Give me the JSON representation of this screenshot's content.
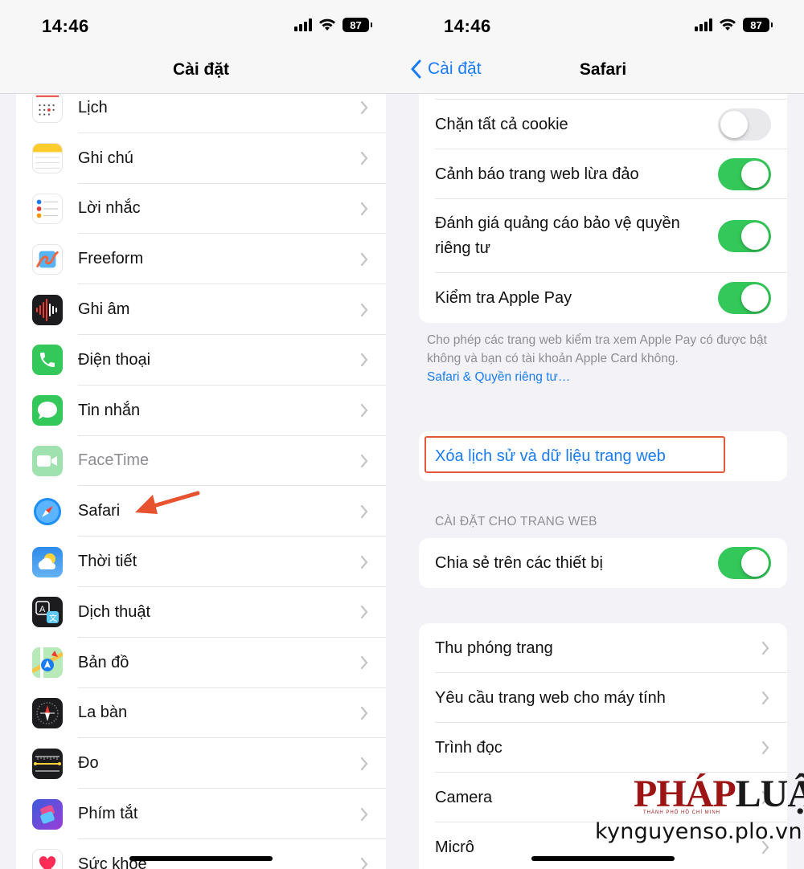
{
  "status": {
    "time": "14:46",
    "battery": "87"
  },
  "left": {
    "title": "Cài đặt",
    "items": [
      {
        "label": "Lịch",
        "icon": "calendar-icon"
      },
      {
        "label": "Ghi chú",
        "icon": "notes-icon"
      },
      {
        "label": "Lời nhắc",
        "icon": "reminders-icon"
      },
      {
        "label": "Freeform",
        "icon": "freeform-icon"
      },
      {
        "label": "Ghi âm",
        "icon": "voice-memos-icon"
      },
      {
        "label": "Điện thoại",
        "icon": "phone-icon"
      },
      {
        "label": "Tin nhắn",
        "icon": "messages-icon"
      },
      {
        "label": "FaceTime",
        "icon": "facetime-icon"
      },
      {
        "label": "Safari",
        "icon": "safari-icon"
      },
      {
        "label": "Thời tiết",
        "icon": "weather-icon"
      },
      {
        "label": "Dịch thuật",
        "icon": "translate-icon"
      },
      {
        "label": "Bản đồ",
        "icon": "maps-icon"
      },
      {
        "label": "La bàn",
        "icon": "compass-icon"
      },
      {
        "label": "Đo",
        "icon": "measure-icon"
      },
      {
        "label": "Phím tắt",
        "icon": "shortcuts-icon"
      },
      {
        "label": "Sức khỏe",
        "icon": "health-icon"
      }
    ]
  },
  "right": {
    "back_label": "Cài đặt",
    "title": "Safari",
    "privacy_group": [
      {
        "label": "Chặn tất cả cookie",
        "toggle": false
      },
      {
        "label": "Cảnh báo trang web lừa đảo",
        "toggle": true
      },
      {
        "label": "Đánh giá quảng cáo bảo vệ quyền riêng tư",
        "toggle": true
      },
      {
        "label": "Kiểm tra Apple Pay",
        "toggle": true
      }
    ],
    "footnote": "Cho phép các trang web kiểm tra xem Apple Pay có được bật không và bạn có tài khoản Apple Card không.",
    "footnote_link": "Safari & Quyền riêng tư…",
    "clear_history": "Xóa lịch sử và dữ liệu trang web",
    "website_settings_header": "CÀI ĐẶT CHO TRANG WEB",
    "share_across_devices": {
      "label": "Chia sẻ trên các thiết bị",
      "toggle": true
    },
    "website_items": [
      "Thu phóng trang",
      "Yêu cầu trang web cho máy tính",
      "Trình đọc",
      "Camera",
      "Micrô"
    ]
  },
  "watermark": {
    "logo_a": "PHÁP",
    "logo_b": "LUẬT",
    "sub": "THÀNH PHỐ HỒ CHÍ MINH",
    "url": "kynguyenso.plo.vn"
  },
  "colors": {
    "accent": "#1a7cf5",
    "toggle_on": "#34c759",
    "highlight": "#e3573a"
  }
}
